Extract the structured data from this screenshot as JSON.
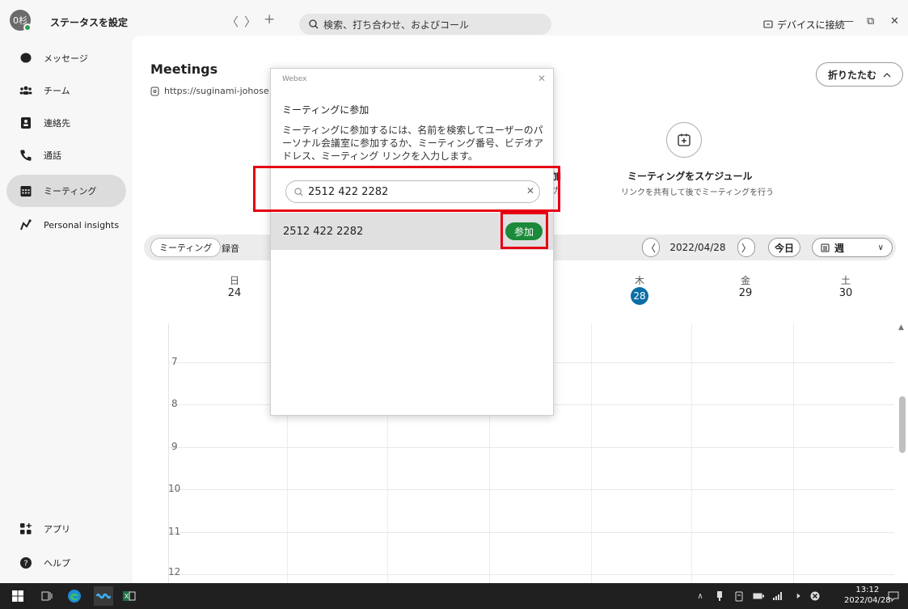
{
  "titlebar": {
    "avatar_initials": "0杉",
    "status_label": "ステータスを設定",
    "nav_back": "〈",
    "nav_forward": "〉",
    "nav_add": "+",
    "search_placeholder": "検索、打ち合わせ、およびコール",
    "device_connect": "デバイスに接続",
    "win_min": "—",
    "win_restore": "⧉",
    "win_close": "✕"
  },
  "sidebar": {
    "items": [
      {
        "label": "メッセージ",
        "icon": "message-bubble-icon"
      },
      {
        "label": "チーム",
        "icon": "team-icon"
      },
      {
        "label": "連絡先",
        "icon": "contacts-icon"
      },
      {
        "label": "通話",
        "icon": "phone-icon"
      },
      {
        "label": "ミーティング",
        "icon": "calendar-icon",
        "active": true
      },
      {
        "label": "Personal insights",
        "icon": "insights-icon"
      }
    ],
    "bottom": [
      {
        "label": "アプリ",
        "icon": "apps-icon"
      },
      {
        "label": "ヘルプ",
        "icon": "help-icon"
      }
    ]
  },
  "main": {
    "title": "Meetings",
    "url": "https://suginami-johose",
    "collapse_label": "折りたたむ",
    "action_join_title": "加",
    "action_join_sub": "力",
    "schedule_title": "ミーティングをスケジュール",
    "schedule_sub": "リンクを共有して後でミーティングを行う"
  },
  "toolbar": {
    "tab_meetings": "ミーティング",
    "tab_recordings": "録音",
    "prev": "〈",
    "date": "2022/04/28",
    "next": "〉",
    "today": "今日",
    "view": "週",
    "view_chevron": "∨"
  },
  "calendar": {
    "days": [
      {
        "dow": "日",
        "num": "24"
      },
      {
        "dow": "木",
        "num": "28",
        "today": true
      },
      {
        "dow": "金",
        "num": "29"
      },
      {
        "dow": "土",
        "num": "30"
      }
    ],
    "hours": [
      "7",
      "8",
      "9",
      "10",
      "11",
      "12"
    ]
  },
  "dialog": {
    "brand": "Webex",
    "close": "✕",
    "title": "ミーティングに参加",
    "description": "ミーティングに参加するには、名前を検索してユーザーのパーソナル会議室に参加するか、ミーティング番号、ビデオアドレス、ミーティング リンクを入力します。",
    "search_value": "2512 422 2282",
    "search_clear": "✕",
    "result_number": "2512 422 2282",
    "join_label": "参加"
  },
  "taskbar": {
    "time": "13:12",
    "date": "2022/04/28"
  },
  "colors": {
    "accent_green": "#1b8a3a",
    "today_blue": "#0b6ea6",
    "highlight_red": "#e60012"
  }
}
